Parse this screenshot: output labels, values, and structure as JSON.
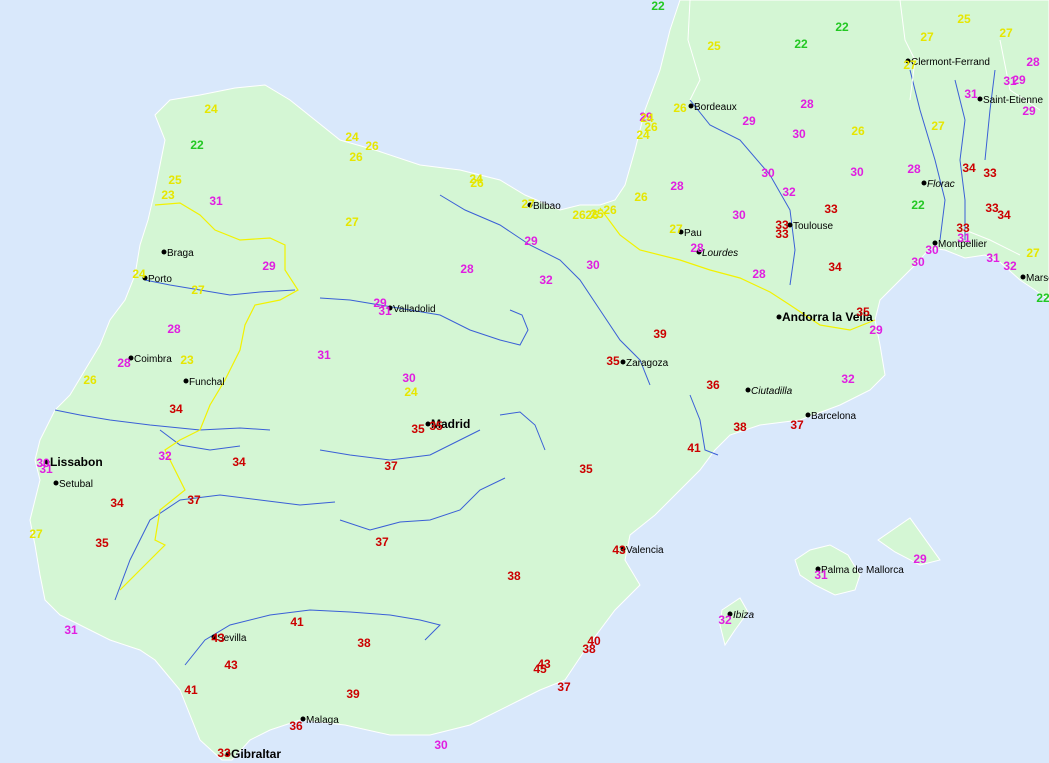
{
  "colors": {
    "sea": "#d9e8fb",
    "land": "#d4f6d4",
    "river": "#3a5fd6",
    "border": "#f2f200",
    "t_green": "#22c822",
    "t_yellow": "#e6e600",
    "t_magenta": "#e01ee0",
    "t_red": "#cc0000"
  },
  "cities": [
    {
      "name": "Clermont-Ferrand",
      "style": "normal"
    },
    {
      "name": "Saint-Etienne",
      "style": "normal"
    },
    {
      "name": "Bordeaux",
      "style": "normal"
    },
    {
      "name": "Florac",
      "style": "italic"
    },
    {
      "name": "Bilbao",
      "style": "normal"
    },
    {
      "name": "Pau",
      "style": "normal"
    },
    {
      "name": "Lourdes",
      "style": "italic"
    },
    {
      "name": "Toulouse",
      "style": "normal"
    },
    {
      "name": "Montpellier",
      "style": "normal"
    },
    {
      "name": "Marseille",
      "style": "normal"
    },
    {
      "name": "Braga",
      "style": "normal"
    },
    {
      "name": "Porto",
      "style": "normal"
    },
    {
      "name": "Valladolid",
      "style": "normal"
    },
    {
      "name": "Andorra la Vella",
      "style": "bold"
    },
    {
      "name": "Zaragoza",
      "style": "normal"
    },
    {
      "name": "Coimbra",
      "style": "normal"
    },
    {
      "name": "Funchal",
      "style": "normal"
    },
    {
      "name": "Ciutadilla",
      "style": "italic"
    },
    {
      "name": "Madrid",
      "style": "bold"
    },
    {
      "name": "Barcelona",
      "style": "normal"
    },
    {
      "name": "Lissabon",
      "style": "bold"
    },
    {
      "name": "Setubal",
      "style": "normal"
    },
    {
      "name": "Valencia",
      "style": "normal"
    },
    {
      "name": "Palma de Mallorca",
      "style": "normal"
    },
    {
      "name": "Ibiza",
      "style": "italic"
    },
    {
      "name": "Sevilla",
      "style": "normal"
    },
    {
      "name": "Malaga",
      "style": "normal"
    },
    {
      "name": "Gibraltar",
      "style": "bold"
    }
  ],
  "temperatures": [
    {
      "value": "22",
      "color": "t_green"
    },
    {
      "value": "25",
      "color": "t_yellow"
    },
    {
      "value": "22",
      "color": "t_green"
    },
    {
      "value": "22",
      "color": "t_green"
    },
    {
      "value": "25",
      "color": "t_yellow"
    },
    {
      "value": "27",
      "color": "t_yellow"
    },
    {
      "value": "27",
      "color": "t_yellow"
    },
    {
      "value": "28",
      "color": "t_magenta"
    },
    {
      "value": "27",
      "color": "t_yellow"
    },
    {
      "value": "31",
      "color": "t_magenta"
    },
    {
      "value": "29",
      "color": "t_magenta"
    },
    {
      "value": "31",
      "color": "t_magenta"
    },
    {
      "value": "29",
      "color": "t_magenta"
    },
    {
      "value": "26",
      "color": "t_yellow"
    },
    {
      "value": "28",
      "color": "t_magenta"
    },
    {
      "value": "29",
      "color": "t_magenta"
    },
    {
      "value": "30",
      "color": "t_magenta"
    },
    {
      "value": "26",
      "color": "t_yellow"
    },
    {
      "value": "27",
      "color": "t_yellow"
    },
    {
      "value": "28",
      "color": "t_magenta"
    },
    {
      "value": "34",
      "color": "t_red"
    },
    {
      "value": "33",
      "color": "t_red"
    },
    {
      "value": "30",
      "color": "t_magenta"
    },
    {
      "value": "22",
      "color": "t_green"
    },
    {
      "value": "33",
      "color": "t_red"
    },
    {
      "value": "34",
      "color": "t_red"
    },
    {
      "value": "33",
      "color": "t_red"
    },
    {
      "value": "33",
      "color": "t_red"
    },
    {
      "value": "31",
      "color": "t_magenta"
    },
    {
      "value": "30",
      "color": "t_magenta"
    },
    {
      "value": "31",
      "color": "t_magenta"
    },
    {
      "value": "32",
      "color": "t_magenta"
    },
    {
      "value": "27",
      "color": "t_yellow"
    },
    {
      "value": "24",
      "color": "t_yellow"
    },
    {
      "value": "24",
      "color": "t_yellow"
    },
    {
      "value": "26",
      "color": "t_yellow"
    },
    {
      "value": "26",
      "color": "t_yellow"
    },
    {
      "value": "24",
      "color": "t_yellow"
    },
    {
      "value": "29",
      "color": "t_magenta"
    },
    {
      "value": "30",
      "color": "t_magenta"
    },
    {
      "value": "28",
      "color": "t_magenta"
    },
    {
      "value": "26",
      "color": "t_yellow"
    },
    {
      "value": "30",
      "color": "t_magenta"
    },
    {
      "value": "32",
      "color": "t_magenta"
    },
    {
      "value": "33",
      "color": "t_red"
    },
    {
      "value": "30",
      "color": "t_magenta"
    },
    {
      "value": "33",
      "color": "t_red"
    },
    {
      "value": "27",
      "color": "t_yellow"
    },
    {
      "value": "28",
      "color": "t_magenta"
    },
    {
      "value": "28",
      "color": "t_magenta"
    },
    {
      "value": "34",
      "color": "t_red"
    },
    {
      "value": "24",
      "color": "t_yellow"
    },
    {
      "value": "22",
      "color": "t_green"
    },
    {
      "value": "24",
      "color": "t_yellow"
    },
    {
      "value": "26",
      "color": "t_yellow"
    },
    {
      "value": "26",
      "color": "t_yellow"
    },
    {
      "value": "26",
      "color": "t_yellow"
    },
    {
      "value": "25",
      "color": "t_yellow"
    },
    {
      "value": "23",
      "color": "t_yellow"
    },
    {
      "value": "31",
      "color": "t_magenta"
    },
    {
      "value": "27",
      "color": "t_yellow"
    },
    {
      "value": "27",
      "color": "t_yellow"
    },
    {
      "value": "26",
      "color": "t_yellow"
    },
    {
      "value": "26",
      "color": "t_yellow"
    },
    {
      "value": "25",
      "color": "t_yellow"
    },
    {
      "value": "29",
      "color": "t_magenta"
    },
    {
      "value": "28",
      "color": "t_magenta"
    },
    {
      "value": "32",
      "color": "t_magenta"
    },
    {
      "value": "30",
      "color": "t_magenta"
    },
    {
      "value": "29",
      "color": "t_magenta"
    },
    {
      "value": "24",
      "color": "t_yellow"
    },
    {
      "value": "27",
      "color": "t_yellow"
    },
    {
      "value": "29",
      "color": "t_magenta"
    },
    {
      "value": "31",
      "color": "t_magenta"
    },
    {
      "value": "35",
      "color": "t_red"
    },
    {
      "value": "29",
      "color": "t_magenta"
    },
    {
      "value": "39",
      "color": "t_red"
    },
    {
      "value": "28",
      "color": "t_magenta"
    },
    {
      "value": "28",
      "color": "t_magenta"
    },
    {
      "value": "23",
      "color": "t_yellow"
    },
    {
      "value": "31",
      "color": "t_magenta"
    },
    {
      "value": "26",
      "color": "t_yellow"
    },
    {
      "value": "30",
      "color": "t_magenta"
    },
    {
      "value": "24",
      "color": "t_yellow"
    },
    {
      "value": "35",
      "color": "t_red"
    },
    {
      "value": "36",
      "color": "t_red"
    },
    {
      "value": "32",
      "color": "t_magenta"
    },
    {
      "value": "34",
      "color": "t_red"
    },
    {
      "value": "35",
      "color": "t_red"
    },
    {
      "value": "35",
      "color": "t_red"
    },
    {
      "value": "38",
      "color": "t_red"
    },
    {
      "value": "37",
      "color": "t_red"
    },
    {
      "value": "41",
      "color": "t_red"
    },
    {
      "value": "30",
      "color": "t_magenta"
    },
    {
      "value": "31",
      "color": "t_magenta"
    },
    {
      "value": "32",
      "color": "t_magenta"
    },
    {
      "value": "34",
      "color": "t_red"
    },
    {
      "value": "37",
      "color": "t_red"
    },
    {
      "value": "35",
      "color": "t_red"
    },
    {
      "value": "34",
      "color": "t_red"
    },
    {
      "value": "37",
      "color": "t_red"
    },
    {
      "value": "27",
      "color": "t_yellow"
    },
    {
      "value": "35",
      "color": "t_red"
    },
    {
      "value": "37",
      "color": "t_red"
    },
    {
      "value": "43",
      "color": "t_red"
    },
    {
      "value": "38",
      "color": "t_red"
    },
    {
      "value": "31",
      "color": "t_magenta"
    },
    {
      "value": "29",
      "color": "t_magenta"
    },
    {
      "value": "31",
      "color": "t_magenta"
    },
    {
      "value": "32",
      "color": "t_magenta"
    },
    {
      "value": "43",
      "color": "t_red"
    },
    {
      "value": "41",
      "color": "t_red"
    },
    {
      "value": "38",
      "color": "t_red"
    },
    {
      "value": "40",
      "color": "t_red"
    },
    {
      "value": "38",
      "color": "t_red"
    },
    {
      "value": "43",
      "color": "t_red"
    },
    {
      "value": "43",
      "color": "t_red"
    },
    {
      "value": "45",
      "color": "t_red"
    },
    {
      "value": "41",
      "color": "t_red"
    },
    {
      "value": "39",
      "color": "t_red"
    },
    {
      "value": "37",
      "color": "t_red"
    },
    {
      "value": "36",
      "color": "t_red"
    },
    {
      "value": "33",
      "color": "t_red"
    },
    {
      "value": "30",
      "color": "t_magenta"
    },
    {
      "value": "22",
      "color": "t_green"
    }
  ]
}
